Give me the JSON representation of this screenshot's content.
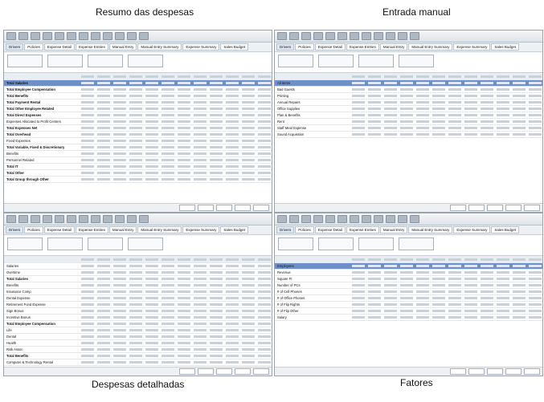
{
  "captions": {
    "top_left": "Resumo das despesas",
    "top_right": "Entrada manual",
    "bottom_left": "Despesas detalhadas",
    "bottom_right": "Fatores"
  },
  "tabs": [
    "Drivers",
    "Policies",
    "Expense Detail",
    "Expense Entries",
    "Manual Entry",
    "Manual Entry Summary",
    "Expense Summary",
    "Sales Budget"
  ],
  "panels": {
    "summary": {
      "rows": [
        "Total Salaries",
        "Total Employee Compensation",
        "Total Benefits",
        "Total Payment Rental",
        "Total Other Employee Related",
        "Total Direct Expenses",
        "Expenses Allocated to Profit Centers",
        "Total Expenses Net",
        "Total Overhead",
        "Fixed Expenses",
        "Total Variable, Fixed & Discretionary",
        "Benefits",
        "Personnel Related",
        "Total IT",
        "Total Other",
        "Total Group through Other"
      ]
    },
    "manual": {
      "rows": [
        "All Items",
        "Bad Guests",
        "Printing",
        "Annual Repairs",
        "Office Supplies",
        "Plan & Benefits",
        "Rent",
        "Staff Meal Expense",
        "Sound Acquisition"
      ]
    },
    "detail": {
      "rows": [
        "Salaries",
        "Overtime",
        "Total Salaries",
        "Benefits",
        "Insurance Comp",
        "Dental Expense",
        "Retirement Fund Expense",
        "Sign Bonus",
        "Incentive Bonus",
        "Total Employee Compensation",
        "Life",
        "Dental",
        "Health",
        "Risk Assoc",
        "Total Benefits",
        "Computer & Technology Rental",
        "Office All Stone Rental",
        "Other Equipment Rental",
        "Total Equipment Rental",
        "Consulting",
        "Travel & Entertainment"
      ]
    },
    "factors": {
      "rows": [
        "Employees",
        "Revenue",
        "Square Ft",
        "Number of PCs",
        "# of Cell Phones",
        "# of Office Phones",
        "# of Flip Rights",
        "# of Flip Other",
        "Salary"
      ]
    }
  }
}
